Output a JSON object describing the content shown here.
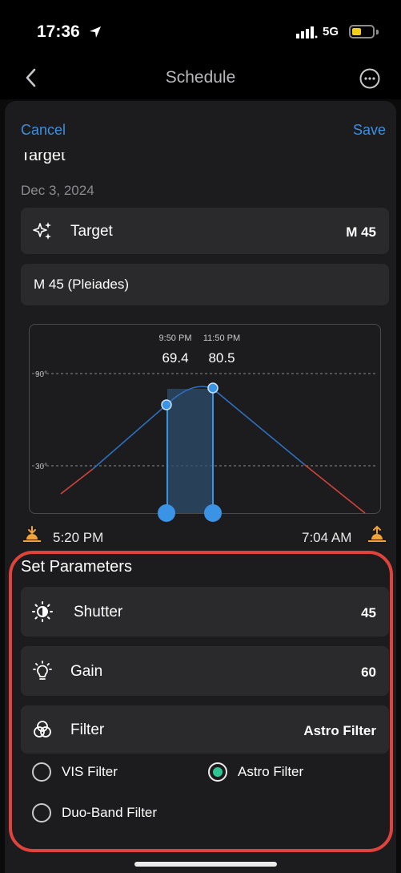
{
  "status_bar": {
    "time": "17:36",
    "network": "5G",
    "battery_level": 0.45,
    "battery_color": "#f2cf1b",
    "icons": [
      "location-arrow-icon",
      "signal-bars-icon",
      "battery-icon"
    ]
  },
  "nav": {
    "title": "Schedule",
    "back_icon": "chevron-left-icon",
    "more_icon": "ellipsis-circle-icon"
  },
  "sheet": {
    "cancel_label": "Cancel",
    "save_label": "Save",
    "section_title": "Target",
    "date": "Dec 3, 2024",
    "accent_color": "#3e8fe0"
  },
  "target_row": {
    "icon": "sparkles-icon",
    "label": "Target",
    "value": "M 45"
  },
  "target_name": "M 45 (Pleiades)",
  "chart_data": {
    "type": "line",
    "title": "",
    "xlabel": "",
    "ylabel": "",
    "y_ticks": [
      "90°",
      "30°"
    ],
    "x_start_label": "5:20 PM",
    "x_end_label": "7:04 AM",
    "window_start_label": "9:50 PM",
    "window_end_label": "11:50 PM",
    "window_start_value": "69.4",
    "window_end_value": "80.5",
    "altitude_curve": [
      {
        "t": 0.0,
        "alt": 12
      },
      {
        "t": 0.2,
        "alt": 34
      },
      {
        "t": 0.4,
        "alt": 68
      },
      {
        "t": 0.5,
        "alt": 80
      },
      {
        "t": 0.56,
        "alt": 81
      },
      {
        "t": 0.7,
        "alt": 56
      },
      {
        "t": 0.9,
        "alt": 20
      },
      {
        "t": 1.0,
        "alt": 0
      }
    ],
    "window": [
      0.416,
      0.533
    ],
    "grid": true,
    "colors": {
      "curve": "#2e6fbf",
      "below_30": "#d0443a",
      "window_fill": "#2d4c6e",
      "handle": "#3a93e5"
    }
  },
  "params": {
    "section_title": "Set Parameters",
    "shutter": {
      "icon": "shutter-icon",
      "label": "Shutter",
      "value": "45"
    },
    "gain": {
      "icon": "lightbulb-icon",
      "label": "Gain",
      "value": "60"
    },
    "filter": {
      "icon": "filter-circles-icon",
      "label": "Filter",
      "value": "Astro Filter"
    },
    "filter_options": [
      {
        "label": "VIS Filter",
        "selected": false
      },
      {
        "label": "Astro Filter",
        "selected": true
      },
      {
        "label": "Duo-Band Filter",
        "selected": false
      }
    ],
    "highlight_color": "#e0433c"
  }
}
